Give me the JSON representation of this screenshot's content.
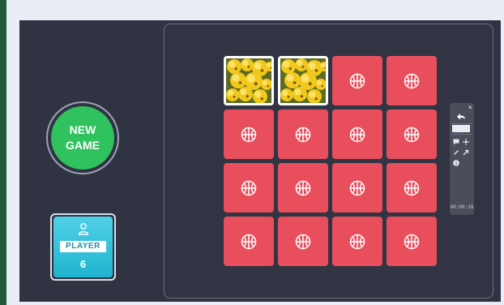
{
  "sidebar": {
    "new_game_label": "NEW GAME",
    "player": {
      "label": "PLAYER",
      "count": "6",
      "icon": "user-icon"
    }
  },
  "board": {
    "rows": 4,
    "columns": 4,
    "cards": [
      {
        "state": "face",
        "image": "yellow-flowers"
      },
      {
        "state": "face",
        "image": "yellow-flowers"
      },
      {
        "state": "back",
        "icon": "basketball-icon"
      },
      {
        "state": "back",
        "icon": "basketball-icon"
      },
      {
        "state": "back",
        "icon": "basketball-icon"
      },
      {
        "state": "back",
        "icon": "basketball-icon"
      },
      {
        "state": "back",
        "icon": "basketball-icon"
      },
      {
        "state": "back",
        "icon": "basketball-icon"
      },
      {
        "state": "back",
        "icon": "basketball-icon"
      },
      {
        "state": "back",
        "icon": "basketball-icon"
      },
      {
        "state": "back",
        "icon": "basketball-icon"
      },
      {
        "state": "back",
        "icon": "basketball-icon"
      },
      {
        "state": "back",
        "icon": "basketball-icon"
      },
      {
        "state": "back",
        "icon": "basketball-icon"
      },
      {
        "state": "back",
        "icon": "basketball-icon"
      },
      {
        "state": "back",
        "icon": "basketball-icon"
      }
    ]
  },
  "toolbar": {
    "close_glyph": "×",
    "timer": "00:00:28",
    "icons": [
      "back-arrow-icon",
      "comment-icon",
      "move-icon",
      "pen-icon",
      "pointer-icon",
      "info-icon"
    ]
  },
  "colors": {
    "background": "#2f3342",
    "card_back": "#e84e5c",
    "new_game": "#2fc25f",
    "player_card": "#20b4d0"
  }
}
